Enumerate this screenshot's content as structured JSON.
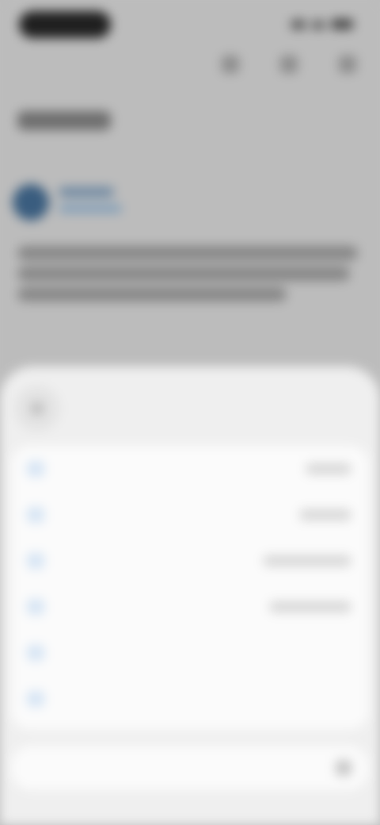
{
  "background_page": {
    "title_placeholder": "",
    "post": {
      "author": "",
      "handle": ""
    }
  },
  "sheet": {
    "title": "",
    "items": [
      {
        "label": "",
        "hint": "",
        "icon": "menu-item-icon"
      },
      {
        "label": "",
        "hint": "",
        "icon": "menu-item-icon"
      },
      {
        "label": "",
        "hint": "",
        "icon": "menu-item-icon"
      },
      {
        "label": "",
        "hint": "",
        "icon": "menu-item-icon"
      },
      {
        "label": "",
        "hint": "",
        "icon": "menu-item-icon"
      },
      {
        "label": "",
        "hint": "",
        "icon": "menu-item-icon",
        "accent": true
      }
    ],
    "input": {
      "placeholder": ""
    }
  },
  "colors": {
    "scrim": "#bcbcbc",
    "sheet_bg": "#efefef",
    "card_bg": "#fbfbfb",
    "accent_blue": "#4a8fe0"
  }
}
